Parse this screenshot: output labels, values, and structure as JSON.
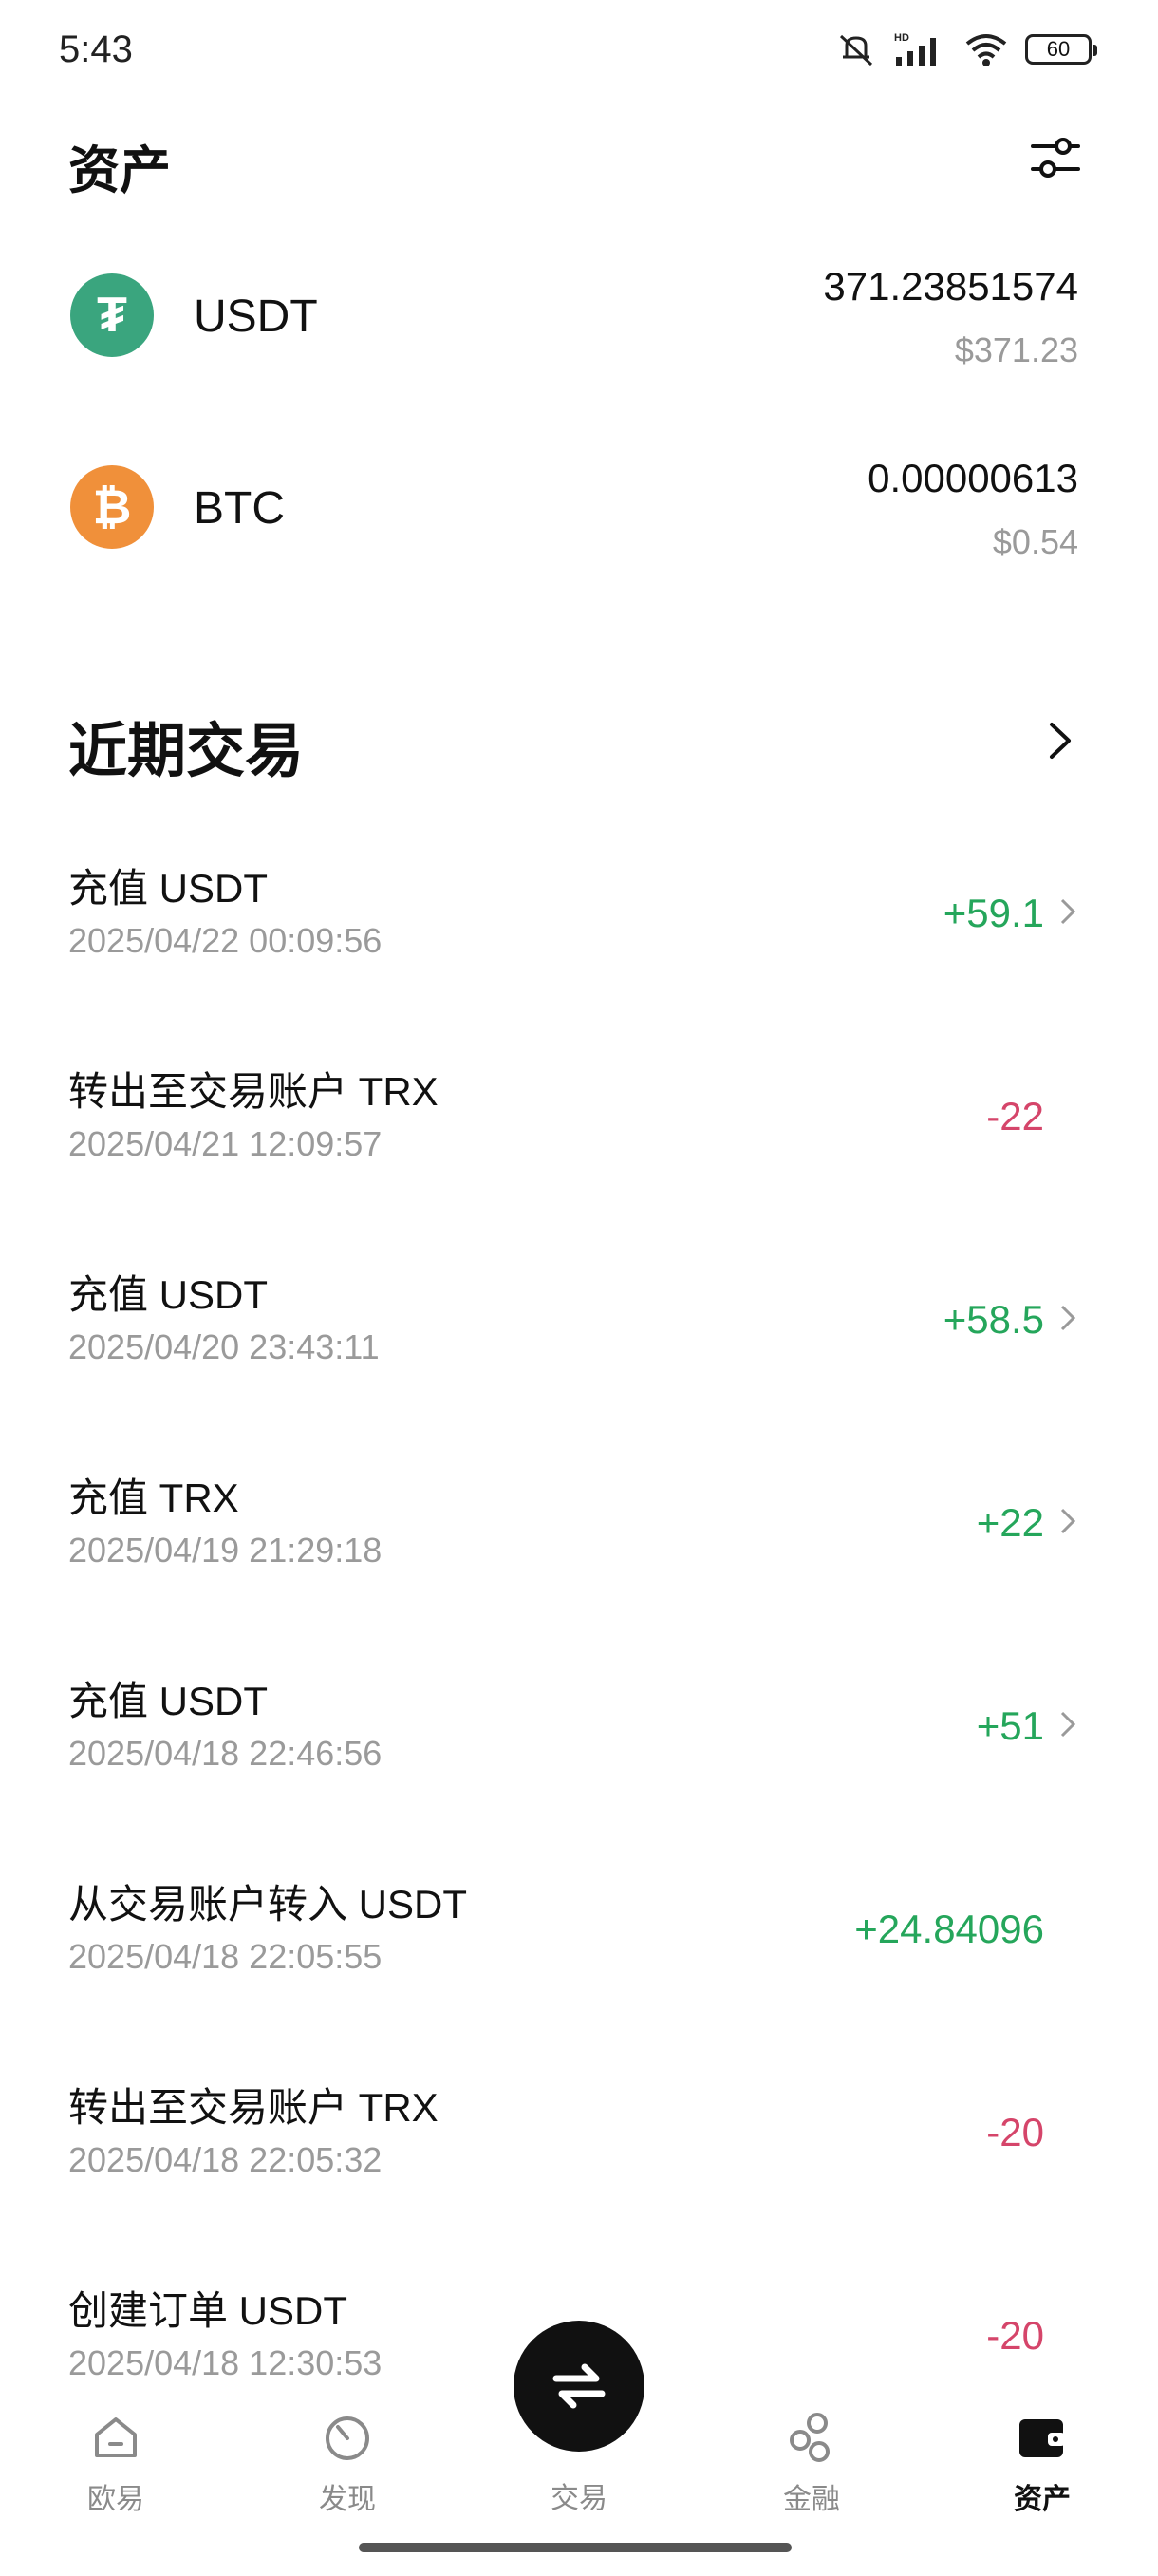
{
  "status_bar": {
    "time": "5:43",
    "battery": "60",
    "network": "HD"
  },
  "header": {
    "title": "资产"
  },
  "assets": [
    {
      "symbol": "USDT",
      "amount": "371.23851574",
      "usd": "$371.23",
      "color": "#3aa57e",
      "glyph": "₮"
    },
    {
      "symbol": "BTC",
      "amount": "0.00000613",
      "usd": "$0.54",
      "color": "#f0903a",
      "glyph": "₿"
    }
  ],
  "recent": {
    "title": "近期交易"
  },
  "transactions": [
    {
      "title": "充值 USDT",
      "time": "2025/04/22 00:09:56",
      "amount": "+59.1",
      "type": "pos",
      "chevron": true
    },
    {
      "title": "转出至交易账户 TRX",
      "time": "2025/04/21 12:09:57",
      "amount": "-22",
      "type": "neg",
      "chevron": false
    },
    {
      "title": "充值 USDT",
      "time": "2025/04/20 23:43:11",
      "amount": "+58.5",
      "type": "pos",
      "chevron": true
    },
    {
      "title": "充值 TRX",
      "time": "2025/04/19 21:29:18",
      "amount": "+22",
      "type": "pos",
      "chevron": true
    },
    {
      "title": "充值 USDT",
      "time": "2025/04/18 22:46:56",
      "amount": "+51",
      "type": "pos",
      "chevron": true
    },
    {
      "title": "从交易账户转入 USDT",
      "time": "2025/04/18 22:05:55",
      "amount": "+24.84096",
      "type": "pos",
      "chevron": false
    },
    {
      "title": "转出至交易账户 TRX",
      "time": "2025/04/18 22:05:32",
      "amount": "-20",
      "type": "neg",
      "chevron": false
    },
    {
      "title": "创建订单 USDT",
      "time": "2025/04/18 12:30:53",
      "amount": "-20",
      "type": "neg",
      "chevron": false
    }
  ],
  "nav": {
    "items": [
      {
        "label": "欧易",
        "icon": "home-icon"
      },
      {
        "label": "发现",
        "icon": "discover-icon"
      },
      {
        "label": "交易",
        "icon": "trade-swap-icon"
      },
      {
        "label": "金融",
        "icon": "finance-icon"
      },
      {
        "label": "资产",
        "icon": "wallet-icon",
        "active": true
      }
    ]
  },
  "colors": {
    "positive": "#25a65b",
    "negative": "#d5456a",
    "muted": "#9a9a9a"
  }
}
